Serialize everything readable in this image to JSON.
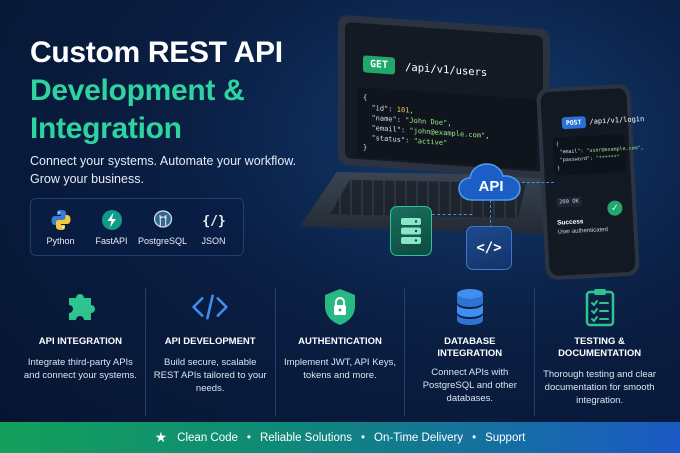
{
  "hero": {
    "line1": "Custom REST API",
    "line2": "Development &",
    "line3": "Integration",
    "tagline_1": "Connect your systems. Automate your workflow.",
    "tagline_2": "Grow your business."
  },
  "tech_stack": [
    {
      "label": "Python",
      "icon": "python-icon"
    },
    {
      "label": "FastAPI",
      "icon": "fastapi-icon"
    },
    {
      "label": "PostgreSQL",
      "icon": "postgresql-icon"
    },
    {
      "label": "JSON",
      "icon": "json-icon"
    }
  ],
  "laptop": {
    "method": "GET",
    "endpoint": "/api/v1/users",
    "code": {
      "open": "{",
      "id_key": "\"id\"",
      "id_val": "101",
      "name_key": "\"name\"",
      "name_val": "\"John Doe\"",
      "email_key": "\"email\"",
      "email_val": "\"john@example.com\"",
      "status_key": "\"status\"",
      "status_val": "\"active\"",
      "close": "}"
    }
  },
  "phone": {
    "method": "POST",
    "endpoint": "/api/v1/login",
    "code": {
      "open": "{",
      "email_key": "\"email\"",
      "email_val": "\"user@example.com\"",
      "password_key": "\"password\"",
      "password_val": "\"******\"",
      "close": "}"
    },
    "status": "200 OK",
    "success_title": "Success",
    "success_sub": "User authenticated"
  },
  "cloud_label": "API",
  "code_tile_label": "</>",
  "features": [
    {
      "title": "API INTEGRATION",
      "title2": "",
      "desc": "Integrate third-party APIs and connect your systems.",
      "icon": "puzzle-icon"
    },
    {
      "title": "API DEVELOPMENT",
      "title2": "",
      "desc": "Build secure, scalable REST APIs tailored to your needs.",
      "icon": "code-brackets-icon"
    },
    {
      "title": "AUTHENTICATION",
      "title2": "",
      "desc": "Implement JWT, API Keys, tokens and more.",
      "icon": "shield-lock-icon"
    },
    {
      "title": "DATABASE",
      "title2": "INTEGRATION",
      "desc": "Connect APIs with PostgreSQL and other databases.",
      "icon": "database-icon"
    },
    {
      "title": "TESTING & DOCUMENTATION",
      "title2": "",
      "desc": "Thorough testing and clear documentation for smooth integration.",
      "icon": "clipboard-check-icon"
    }
  ],
  "banner": {
    "items": [
      "Clean Code",
      "Reliable Solutions",
      "On-Time Delivery",
      "Support"
    ],
    "separator": "•"
  },
  "colors": {
    "accent_green": "#2ed3a0",
    "background": "#0a1e42",
    "get_badge": "#1fa86a",
    "post_badge": "#2b6fd8"
  }
}
